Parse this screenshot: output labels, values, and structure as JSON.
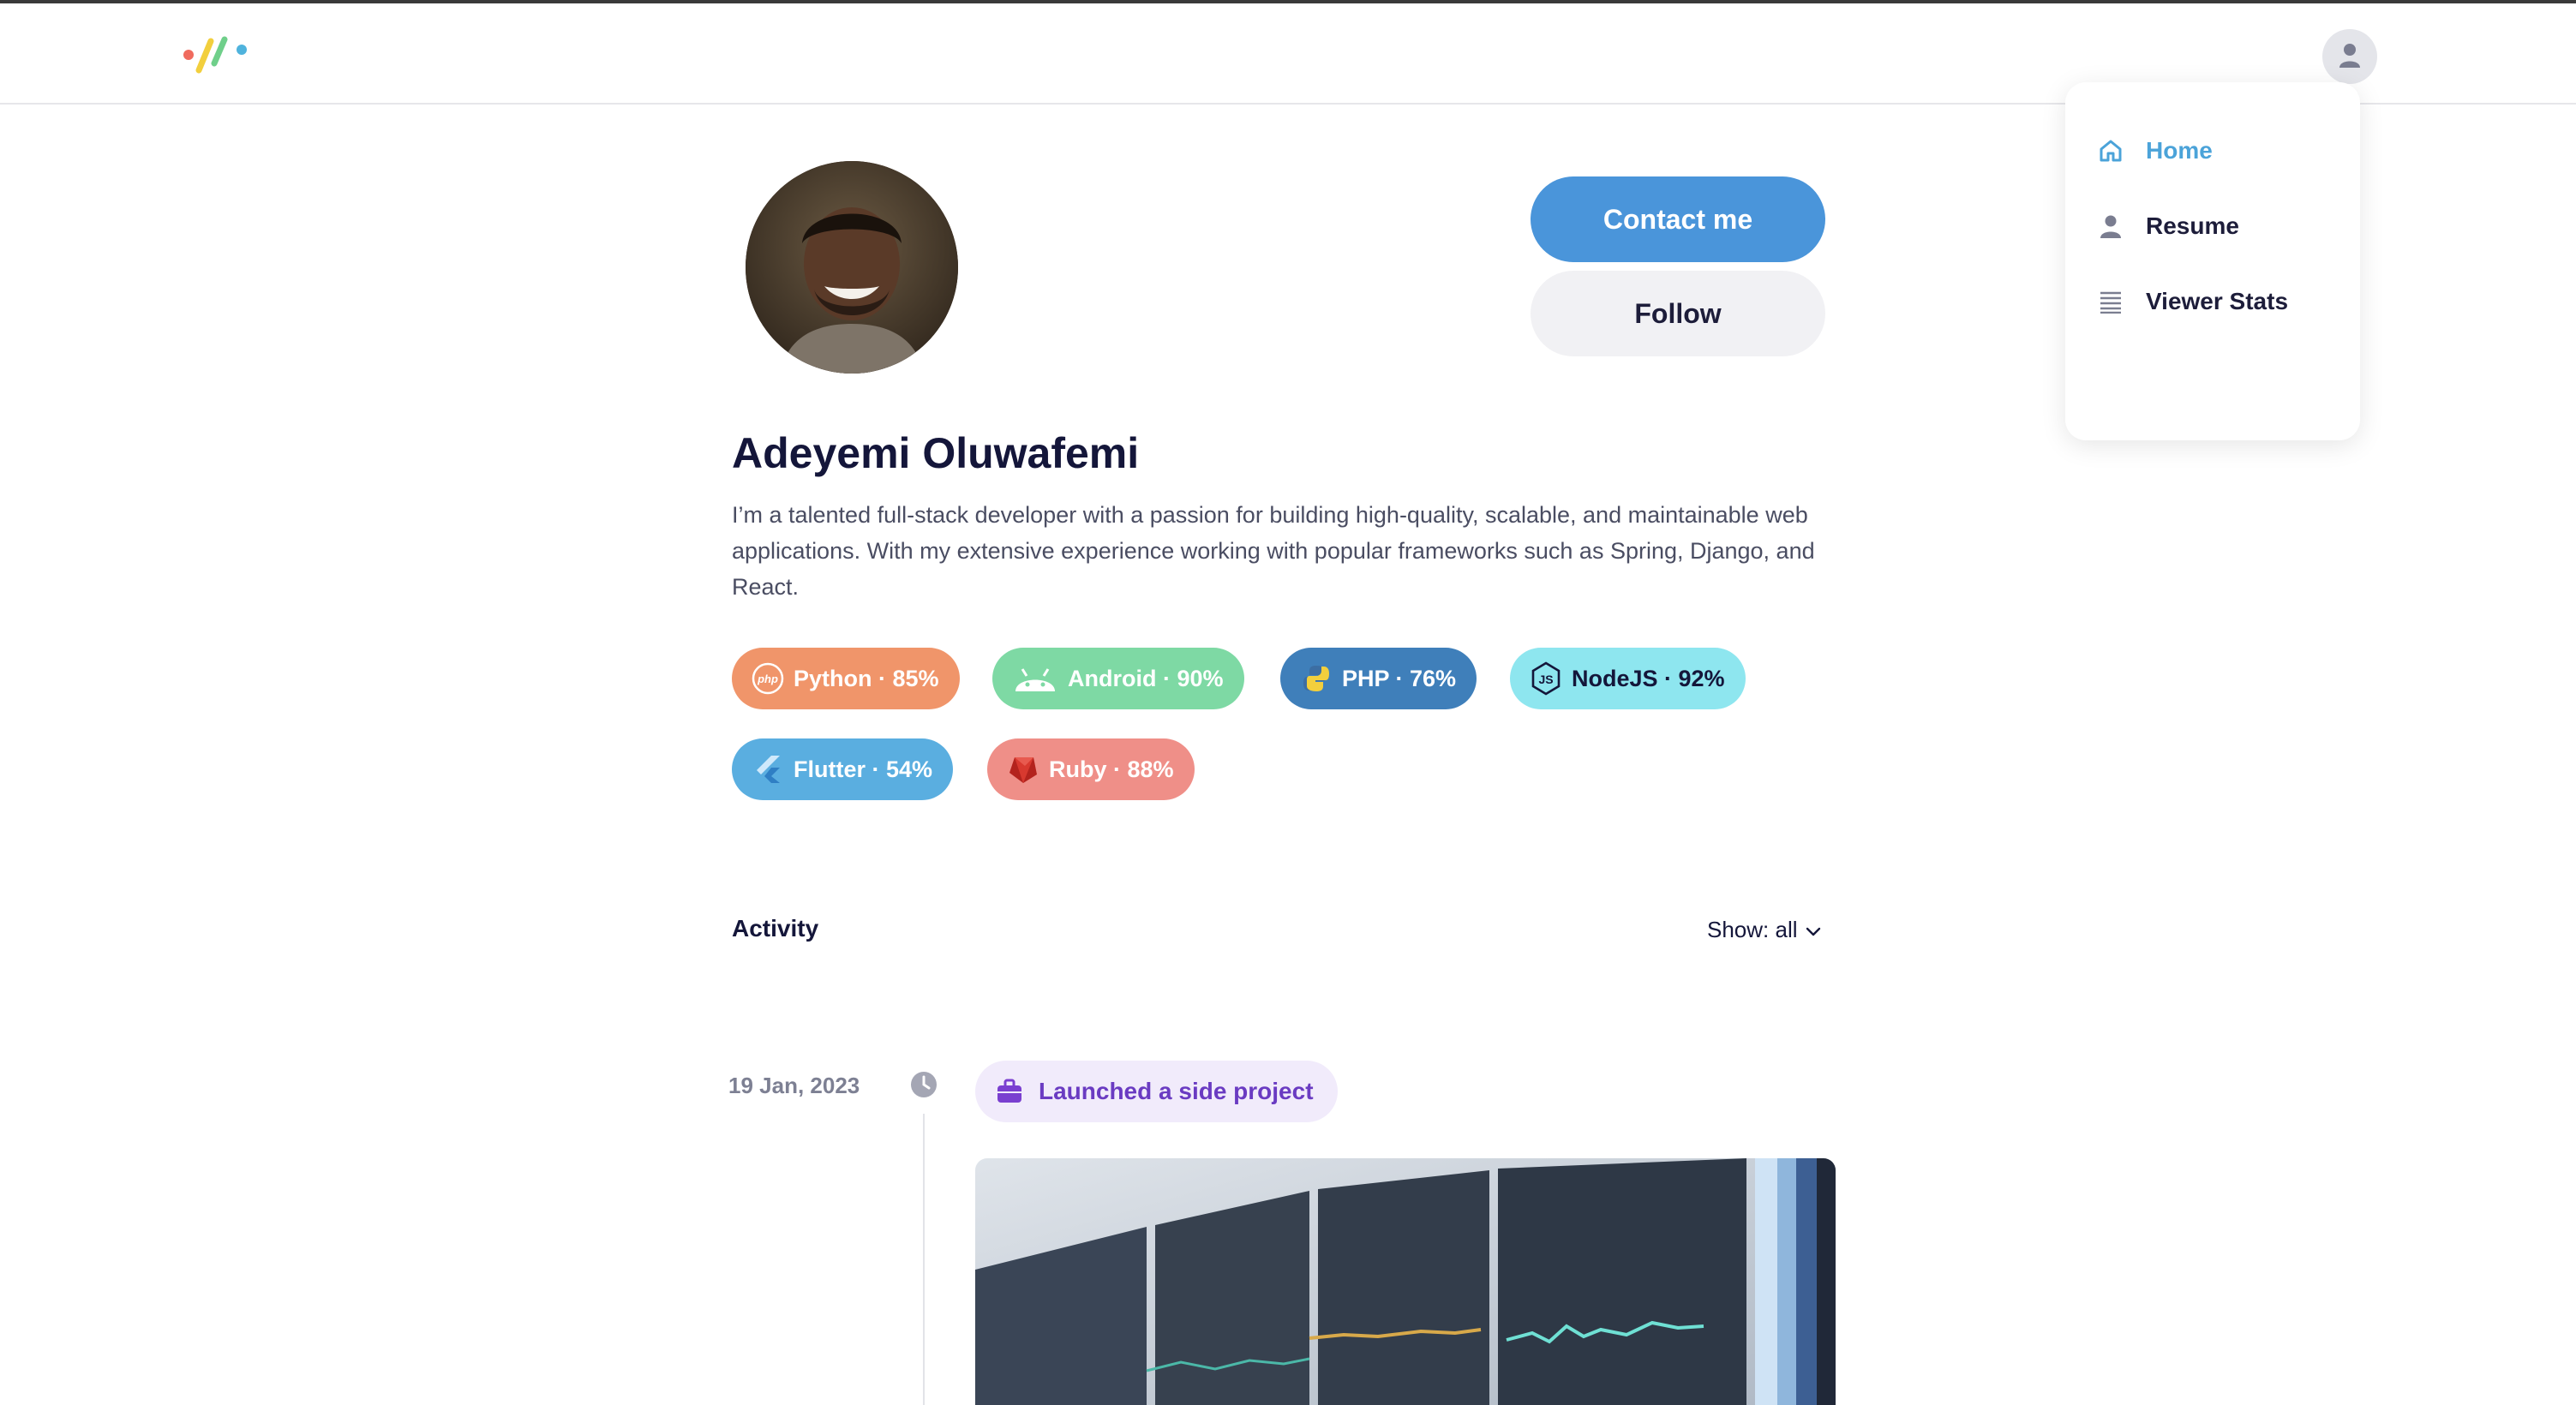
{
  "header": {
    "logo_icon": "brand-logo",
    "account_icon": "user-icon"
  },
  "menu": {
    "items": [
      {
        "label": "Home",
        "icon": "home-icon",
        "active": true
      },
      {
        "label": "Resume",
        "icon": "user-icon",
        "active": false
      },
      {
        "label": "Viewer Stats",
        "icon": "list-icon",
        "active": false
      }
    ]
  },
  "profile": {
    "name": "Adeyemi Oluwafemi",
    "bio": "I’m a talented full-stack developer with a passion for building high-quality, scalable, and maintainable web applications. With my extensive experience working with popular frameworks such as Spring, Django, and React.",
    "contact_label": "Contact me",
    "follow_label": "Follow"
  },
  "skills": [
    {
      "label": "Python · 85%",
      "icon": "php-icon",
      "color": "#f0956a"
    },
    {
      "label": "Android · 90%",
      "icon": "android-icon",
      "color": "#7ed9a4"
    },
    {
      "label": "PHP · 76%",
      "icon": "python-icon",
      "color": "#3f7fba"
    },
    {
      "label": "NodeJS · 92%",
      "icon": "nodejs-icon",
      "color": "#8ee6ef"
    },
    {
      "label": "Flutter · 54%",
      "icon": "flutter-icon",
      "color": "#5aaee0"
    },
    {
      "label": "Ruby · 88%",
      "icon": "ruby-icon",
      "color": "#ef8f88"
    }
  ],
  "activity": {
    "title": "Activity",
    "filter_label": "Show: all",
    "events": [
      {
        "date": "19 Jan, 2023",
        "label": "Launched a side project",
        "icon": "briefcase-icon"
      }
    ]
  },
  "colors": {
    "primary": "#4a95da",
    "menu_active": "#4ba3d9",
    "event_accent": "#6a3bc2"
  }
}
